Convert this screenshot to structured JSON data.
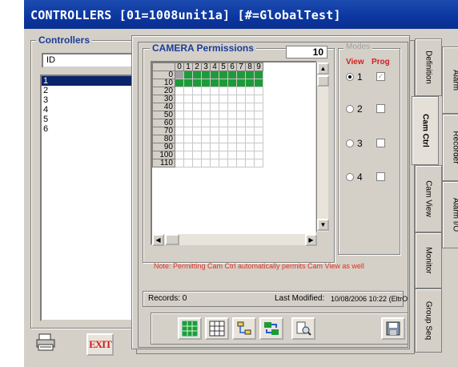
{
  "window": {
    "title": "CONTROLLERS  [01=1008unit1a]  [#=GlobalTest]"
  },
  "left_panel": {
    "group_title": "Controllers",
    "combo_value": "ID",
    "combo_arrow": "chevron-down-icon",
    "list_items": [
      "1",
      "2",
      "3",
      "4",
      "5",
      "6"
    ],
    "selected_index": 0,
    "exit_label": "EXIT"
  },
  "camera_permissions": {
    "group_title": "CAMERA Permissions",
    "count": "10",
    "column_headers": [
      "0",
      "1",
      "2",
      "3",
      "4",
      "5",
      "6",
      "7",
      "8",
      "9"
    ],
    "row_headers": [
      "0",
      "10",
      "20",
      "30",
      "40",
      "50",
      "60",
      "70",
      "80",
      "90",
      "100",
      "110"
    ],
    "permitted_rows": [
      0,
      1
    ],
    "colors": {
      "permitted": "#1f9a3a",
      "selected_cell": "#a0a0a0"
    },
    "note": "Note: Permitting Cam Ctrl automatically permits Cam View as well"
  },
  "modes": {
    "group_title": "Modes",
    "view_header": "View",
    "prog_header": "Prog",
    "options": [
      {
        "label": "1",
        "view_checked": true,
        "prog_checked": true
      },
      {
        "label": "2",
        "view_checked": false,
        "prog_checked": false
      },
      {
        "label": "3",
        "view_checked": false,
        "prog_checked": false
      },
      {
        "label": "4",
        "view_checked": false,
        "prog_checked": false
      }
    ]
  },
  "status": {
    "records_label": "Records:  0",
    "last_modified_label": "Last Modified:",
    "last_modified_value": "10/08/2006 10:22 (EltrO"
  },
  "toolbar": {
    "buttons": [
      "grid-select-all-icon",
      "grid-clear-icon",
      "hierarchy-icon",
      "transfer-icon",
      "find-icon",
      "save-icon"
    ]
  },
  "tabs": {
    "front": [
      "Definition",
      "Cam Ctrl",
      "Cam View",
      "Monitor",
      "Group Seq"
    ],
    "back": [
      "Alarm",
      "Recorder",
      "Alarm I/O"
    ],
    "active": "Cam Ctrl"
  }
}
